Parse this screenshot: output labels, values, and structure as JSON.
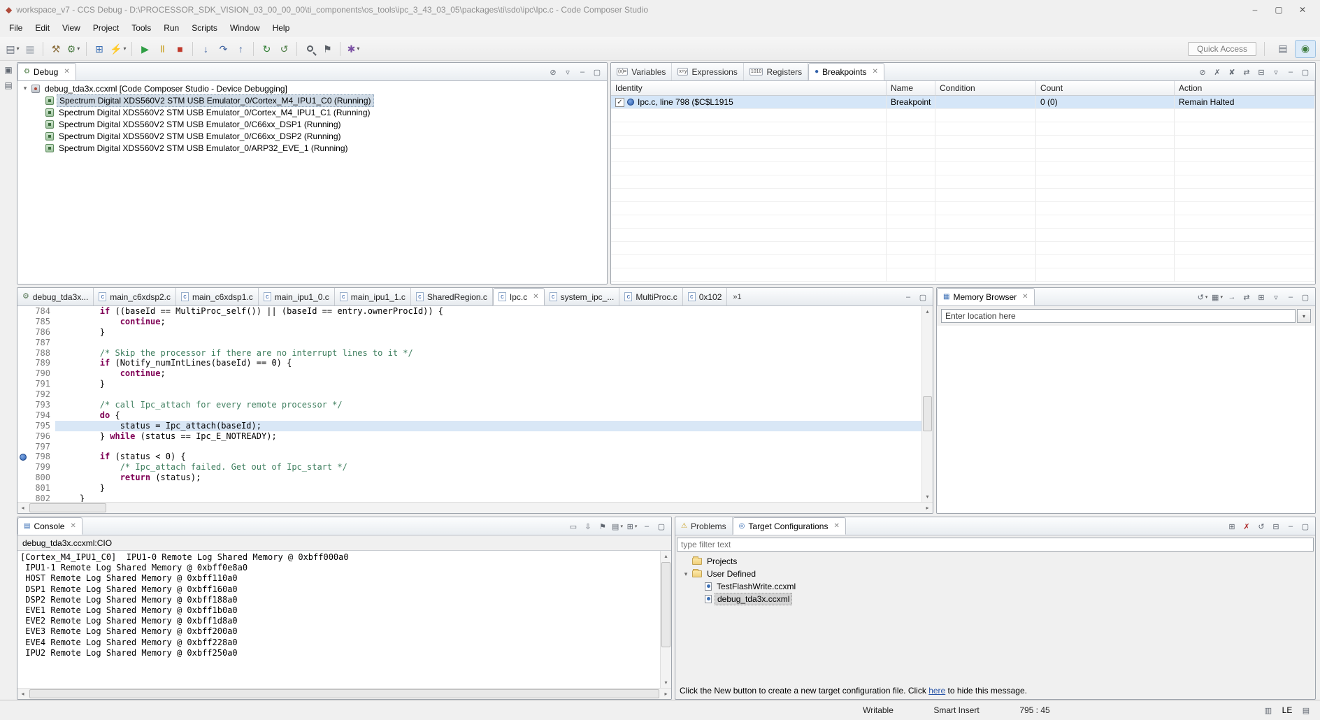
{
  "window": {
    "title": "workspace_v7 - CCS Debug - D:\\PROCESSOR_SDK_VISION_03_00_00_00\\ti_components\\os_tools\\ipc_3_43_03_05\\packages\\ti\\sdo\\ipc\\Ipc.c - Code Composer Studio"
  },
  "menubar": {
    "items": [
      "File",
      "Edit",
      "View",
      "Project",
      "Tools",
      "Run",
      "Scripts",
      "Window",
      "Help"
    ]
  },
  "toolbar": {
    "quick_access_label": "Quick Access",
    "icons": [
      {
        "name": "new-icon",
        "glyph": "▤",
        "color": "#6d7480",
        "dropdown": true
      },
      {
        "name": "save-icon",
        "glyph": "▦",
        "color": "#aab0b8"
      },
      {
        "name": "separator"
      },
      {
        "name": "build-icon",
        "glyph": "⚒",
        "color": "#8a6d3b"
      },
      {
        "name": "debug-icon",
        "glyph": "⚙",
        "color": "#4e7d46",
        "dropdown": true
      },
      {
        "name": "separator"
      },
      {
        "name": "new-target-config-icon",
        "glyph": "⊞",
        "color": "#3b6fb5"
      },
      {
        "name": "flash-icon",
        "glyph": "⚡",
        "color": "#c98a1e",
        "dropdown": true
      },
      {
        "name": "separator"
      },
      {
        "name": "resume-icon",
        "glyph": "▶",
        "color": "#2f9e44"
      },
      {
        "name": "suspend-icon",
        "glyph": "Ⅱ",
        "color": "#c9a227"
      },
      {
        "name": "terminate-icon",
        "glyph": "■",
        "color": "#c0392b"
      },
      {
        "name": "separator"
      },
      {
        "name": "step-into-icon",
        "glyph": "↓",
        "color": "#3b5f9e"
      },
      {
        "name": "step-over-icon",
        "glyph": "↷",
        "color": "#3b5f9e"
      },
      {
        "name": "step-return-icon",
        "glyph": "↑",
        "color": "#3b5f9e"
      },
      {
        "name": "separator"
      },
      {
        "name": "restart-icon",
        "glyph": "↻",
        "color": "#2e7d32"
      },
      {
        "name": "refresh-icon",
        "glyph": "↺",
        "color": "#4e7d46"
      },
      {
        "name": "separator"
      },
      {
        "name": "search-icon",
        "glyph": "",
        "css": "search",
        "color": "#5a5f66"
      },
      {
        "name": "pin-icon",
        "glyph": "⚑",
        "color": "#5a5f66"
      },
      {
        "name": "separator"
      },
      {
        "name": "advanced-scripting-icon",
        "glyph": "✱",
        "color": "#7a4fa3",
        "dropdown": true
      }
    ],
    "perspectives": [
      {
        "name": "ccs-edit-perspective-icon",
        "glyph": "▤",
        "color": "#6d7480",
        "active": false
      },
      {
        "name": "ccs-debug-perspective-icon",
        "glyph": "◉",
        "color": "#3f7d3f",
        "active": true
      }
    ]
  },
  "debug_panel": {
    "tab_label": "Debug",
    "root_label": "debug_tda3x.ccxml [Code Composer Studio - Device Debugging]",
    "threads": [
      {
        "label": "Spectrum Digital XDS560V2 STM USB Emulator_0/Cortex_M4_IPU1_C0 (Running)",
        "selected": true
      },
      {
        "label": "Spectrum Digital XDS560V2 STM USB Emulator_0/Cortex_M4_IPU1_C1 (Running)",
        "selected": false
      },
      {
        "label": "Spectrum Digital XDS560V2 STM USB Emulator_0/C66xx_DSP1 (Running)",
        "selected": false
      },
      {
        "label": "Spectrum Digital XDS560V2 STM USB Emulator_0/C66xx_DSP2 (Running)",
        "selected": false
      },
      {
        "label": "Spectrum Digital XDS560V2 STM USB Emulator_0/ARP32_EVE_1 (Running)",
        "selected": false
      }
    ],
    "actions": [
      {
        "name": "disconnect-icon",
        "glyph": "⊘"
      },
      {
        "name": "view-menu-icon",
        "glyph": "▿"
      },
      {
        "name": "minimize-icon",
        "glyph": "–"
      },
      {
        "name": "maximize-icon",
        "glyph": "▢"
      }
    ]
  },
  "breakpoints_panel": {
    "tabs": [
      {
        "label": "Variables",
        "icon": "variables-icon",
        "icon_text": "(x)=",
        "active": false
      },
      {
        "label": "Expressions",
        "icon": "expressions-icon",
        "icon_text": "x+y",
        "active": false
      },
      {
        "label": "Registers",
        "icon": "registers-icon",
        "icon_text": "1010",
        "active": false
      },
      {
        "label": "Breakpoints",
        "icon": "breakpoints-icon",
        "icon_text": "●",
        "active": true
      }
    ],
    "columns": [
      "Identity",
      "Name",
      "Condition",
      "Count",
      "Action"
    ],
    "rows": [
      {
        "checked": true,
        "identity": "Ipc.c, line 798 ($C$L1915",
        "name": "Breakpoint",
        "condition": "",
        "count": "0 (0)",
        "action": "Remain Halted",
        "selected": true
      }
    ],
    "actions": [
      {
        "name": "skip-all-breakpoints-icon",
        "glyph": "⊘"
      },
      {
        "name": "remove-breakpoint-icon",
        "glyph": "✗"
      },
      {
        "name": "remove-all-breakpoints-icon",
        "glyph": "✘"
      },
      {
        "name": "link-with-debug-view-icon",
        "glyph": "⇄"
      },
      {
        "name": "collapse-all-icon",
        "glyph": "⊟"
      },
      {
        "name": "view-menu-icon",
        "glyph": "▿"
      },
      {
        "name": "minimize-icon",
        "glyph": "–"
      },
      {
        "name": "maximize-icon",
        "glyph": "▢"
      }
    ]
  },
  "editor": {
    "tabs": [
      {
        "label": "debug_tda3x...",
        "kind": "config",
        "active": false
      },
      {
        "label": "main_c6xdsp2.c",
        "kind": "c",
        "active": false
      },
      {
        "label": "main_c6xdsp1.c",
        "kind": "c",
        "active": false
      },
      {
        "label": "main_ipu1_0.c",
        "kind": "c",
        "active": false
      },
      {
        "label": "main_ipu1_1.c",
        "kind": "c",
        "active": false
      },
      {
        "label": "SharedRegion.c",
        "kind": "c",
        "active": false
      },
      {
        "label": "Ipc.c",
        "kind": "c",
        "active": true
      },
      {
        "label": "system_ipc_...",
        "kind": "c",
        "active": false
      },
      {
        "label": "MultiProc.c",
        "kind": "c",
        "active": false
      },
      {
        "label": "0x102",
        "kind": "c",
        "active": false
      }
    ],
    "overflow_count": "»1",
    "current_line": "795",
    "breakpoint_line": "798",
    "lines": [
      {
        "n": "784",
        "t": "        if ((baseId == MultiProc_self()) || (baseId == entry.ownerProcId)) {"
      },
      {
        "n": "785",
        "t": "            continue;"
      },
      {
        "n": "786",
        "t": "        }"
      },
      {
        "n": "787",
        "t": ""
      },
      {
        "n": "788",
        "t": "        /* Skip the processor if there are no interrupt lines to it */"
      },
      {
        "n": "789",
        "t": "        if (Notify_numIntLines(baseId) == 0) {"
      },
      {
        "n": "790",
        "t": "            continue;"
      },
      {
        "n": "791",
        "t": "        }"
      },
      {
        "n": "792",
        "t": ""
      },
      {
        "n": "793",
        "t": "        /* call Ipc_attach for every remote processor */"
      },
      {
        "n": "794",
        "t": "        do {"
      },
      {
        "n": "795",
        "t": "            status = Ipc_attach(baseId);"
      },
      {
        "n": "796",
        "t": "        } while (status == Ipc_E_NOTREADY);"
      },
      {
        "n": "797",
        "t": ""
      },
      {
        "n": "798",
        "t": "        if (status < 0) {"
      },
      {
        "n": "799",
        "t": "            /* Ipc_attach failed. Get out of Ipc_start */"
      },
      {
        "n": "800",
        "t": "            return (status);"
      },
      {
        "n": "801",
        "t": "        }"
      },
      {
        "n": "802",
        "t": "    }"
      }
    ],
    "actions": [
      {
        "name": "minimize-icon",
        "glyph": "–"
      },
      {
        "name": "maximize-icon",
        "glyph": "▢"
      }
    ]
  },
  "memory_panel": {
    "tab_label": "Memory Browser",
    "location_value": "Enter location here",
    "actions": [
      {
        "name": "refresh-memory-icon",
        "glyph": "↺",
        "dropdown": true
      },
      {
        "name": "save-memory-icon",
        "glyph": "▦",
        "dropdown": true
      },
      {
        "name": "go-to-address-icon",
        "glyph": "→"
      },
      {
        "name": "link-icon",
        "glyph": "⇄"
      },
      {
        "name": "new-tab-icon",
        "glyph": "⊞"
      },
      {
        "name": "view-menu-icon",
        "glyph": "▿"
      },
      {
        "name": "minimize-icon",
        "glyph": "–"
      },
      {
        "name": "maximize-icon",
        "glyph": "▢"
      }
    ]
  },
  "console_panel": {
    "tab_label": "Console",
    "console_name": "debug_tda3x.ccxml:CIO",
    "lines": [
      "[Cortex_M4_IPU1_C0]  IPU1-0 Remote Log Shared Memory @ 0xbff000a0",
      " IPU1-1 Remote Log Shared Memory @ 0xbff0e8a0",
      " HOST Remote Log Shared Memory @ 0xbff110a0",
      " DSP1 Remote Log Shared Memory @ 0xbff160a0",
      " DSP2 Remote Log Shared Memory @ 0xbff188a0",
      " EVE1 Remote Log Shared Memory @ 0xbff1b0a0",
      " EVE2 Remote Log Shared Memory @ 0xbff1d8a0",
      " EVE3 Remote Log Shared Memory @ 0xbff200a0",
      " EVE4 Remote Log Shared Memory @ 0xbff228a0",
      " IPU2 Remote Log Shared Memory @ 0xbff250a0"
    ],
    "actions": [
      {
        "name": "clear-console-icon",
        "glyph": "▭"
      },
      {
        "name": "scroll-lock-icon",
        "glyph": "⇩"
      },
      {
        "name": "pin-console-icon",
        "glyph": "⚑"
      },
      {
        "name": "display-selected-console-icon",
        "glyph": "▤",
        "dropdown": true
      },
      {
        "name": "open-console-icon",
        "glyph": "⊞",
        "dropdown": true
      },
      {
        "name": "minimize-icon",
        "glyph": "–"
      },
      {
        "name": "maximize-icon",
        "glyph": "▢"
      }
    ]
  },
  "target_panel": {
    "tabs": [
      {
        "label": "Problems",
        "icon": "problems-icon",
        "icon_text": "⚠",
        "active": false
      },
      {
        "label": "Target Configurations",
        "icon": "target-configurations-icon",
        "icon_text": "◎",
        "active": true
      }
    ],
    "filter_placeholder": "type filter text",
    "tree": [
      {
        "label": "Projects",
        "type": "folder",
        "level": 0,
        "expanded": false,
        "selected": false
      },
      {
        "label": "User Defined",
        "type": "folder",
        "level": 0,
        "expanded": true,
        "selected": false
      },
      {
        "label": "TestFlashWrite.ccxml",
        "type": "file",
        "level": 1,
        "expanded": false,
        "selected": false
      },
      {
        "label": "debug_tda3x.ccxml",
        "type": "file",
        "level": 1,
        "expanded": false,
        "selected": true
      }
    ],
    "message_before": "Click the New button to create a new target configuration file. Click ",
    "message_link": "here",
    "message_after": " to hide this message.",
    "actions": [
      {
        "name": "new-target-icon",
        "glyph": "⊞"
      },
      {
        "name": "delete-target-icon",
        "glyph": "✗",
        "color": "#b03030"
      },
      {
        "name": "refresh-target-icon",
        "glyph": "↺"
      },
      {
        "name": "collapse-all-icon",
        "glyph": "⊟"
      },
      {
        "name": "minimize-icon",
        "glyph": "–"
      },
      {
        "name": "maximize-icon",
        "glyph": "▢"
      }
    ]
  },
  "statusbar": {
    "writable": "Writable",
    "insert_mode": "Smart Insert",
    "position": "795 : 45",
    "endianness": "LE"
  }
}
